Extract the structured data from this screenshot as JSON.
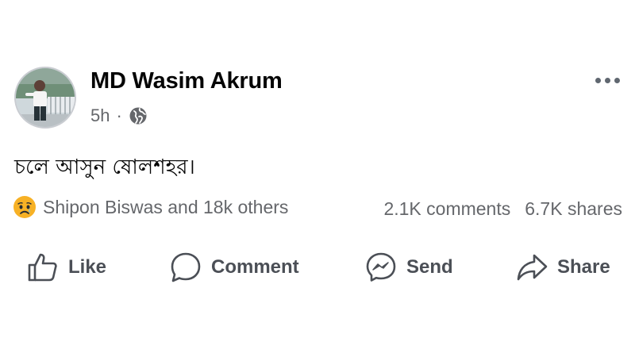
{
  "post": {
    "author": "MD Wasim Akrum",
    "time": "5h",
    "separator": "·",
    "audience_icon": "globe-icon",
    "more_icon": "more-horizontal-icon",
    "text": "চলে আসুন ষোলশহর।"
  },
  "reactions": {
    "emoji_icon": "sad-reaction-icon",
    "summary": "Shipon Biswas and 18k others",
    "comments": "2.1K comments",
    "shares": "6.7K shares"
  },
  "actions": [
    {
      "label": "Like",
      "icon": "thumbs-up-icon"
    },
    {
      "label": "Comment",
      "icon": "comment-bubble-icon"
    },
    {
      "label": "Send",
      "icon": "messenger-icon"
    },
    {
      "label": "Share",
      "icon": "share-arrow-icon"
    }
  ],
  "colors": {
    "text_primary": "#050505",
    "text_secondary": "#65676b",
    "action_text": "#4b4f56",
    "reaction_yellow": "#f7b125"
  }
}
